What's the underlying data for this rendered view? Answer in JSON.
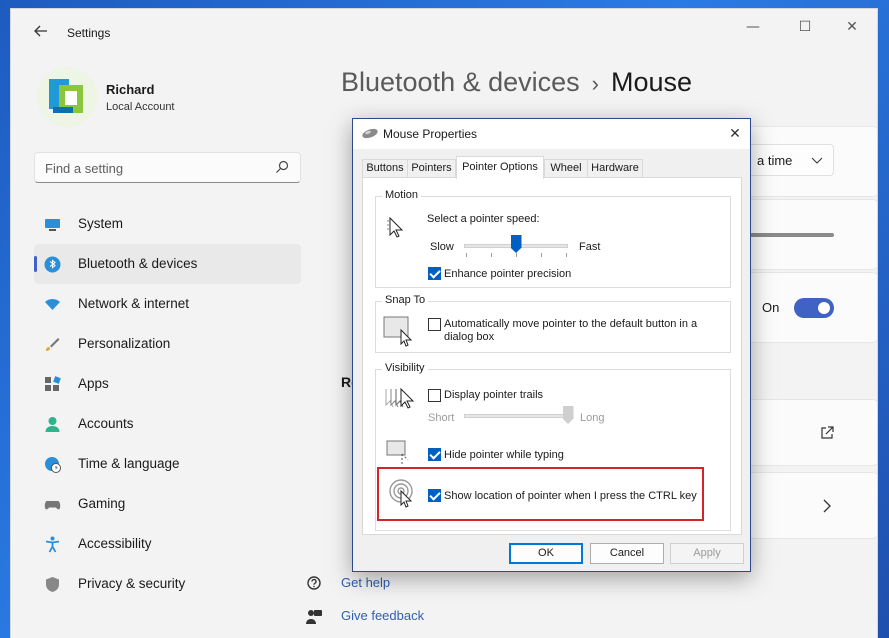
{
  "window": {
    "title": "Settings",
    "back_icon": "arrow-left-icon",
    "minimize_glyph": "—",
    "maximize_glyph": "☐",
    "close_glyph": "✕"
  },
  "profile": {
    "name": "Richard",
    "account_type": "Local Account"
  },
  "search": {
    "placeholder": "Find a setting"
  },
  "nav": {
    "items": [
      {
        "label": "System",
        "icon": "monitor-icon"
      },
      {
        "label": "Bluetooth & devices",
        "icon": "bluetooth-icon",
        "active": true
      },
      {
        "label": "Network & internet",
        "icon": "wifi-icon"
      },
      {
        "label": "Personalization",
        "icon": "brush-icon"
      },
      {
        "label": "Apps",
        "icon": "apps-icon"
      },
      {
        "label": "Accounts",
        "icon": "person-icon"
      },
      {
        "label": "Time & language",
        "icon": "globe-clock-icon"
      },
      {
        "label": "Gaming",
        "icon": "gamepad-icon"
      },
      {
        "label": "Accessibility",
        "icon": "accessibility-icon"
      },
      {
        "label": "Privacy & security",
        "icon": "shield-icon"
      }
    ]
  },
  "header": {
    "parent": "Bluetooth & devices",
    "separator": "›",
    "current": "Mouse"
  },
  "background_cards": {
    "scroll_dropdown_value": "a time",
    "toggle_label": "On",
    "section_fragment": "Re"
  },
  "help": {
    "get_help": "Get help",
    "give_feedback": "Give feedback"
  },
  "dialog": {
    "title": "Mouse Properties",
    "close_glyph": "✕",
    "tabs": [
      {
        "label": "Buttons"
      },
      {
        "label": "Pointers"
      },
      {
        "label": "Pointer Options",
        "active": true
      },
      {
        "label": "Wheel"
      },
      {
        "label": "Hardware"
      }
    ],
    "motion": {
      "label": "Motion",
      "speed_label": "Select a pointer speed:",
      "slow": "Slow",
      "fast": "Fast",
      "speed_value": 0.5,
      "enhance_precision": {
        "label": "Enhance pointer precision",
        "checked": true
      }
    },
    "snap_to": {
      "label": "Snap To",
      "auto_move": {
        "label_line1": "Automatically move pointer to the default button in a",
        "label_line2": "dialog box",
        "checked": false
      }
    },
    "visibility": {
      "label": "Visibility",
      "trails": {
        "label": "Display pointer trails",
        "checked": false
      },
      "short": "Short",
      "long": "Long",
      "trail_value": 1.0,
      "hide_typing": {
        "label": "Hide pointer while typing",
        "checked": true
      },
      "show_location": {
        "label": "Show location of pointer when I press the CTRL key",
        "checked": true
      }
    },
    "buttons": {
      "ok": "OK",
      "cancel": "Cancel",
      "apply": "Apply"
    }
  },
  "colors": {
    "accent": "#4062c4",
    "highlight": "#d4232a",
    "dialog_accent": "#0060c0"
  }
}
